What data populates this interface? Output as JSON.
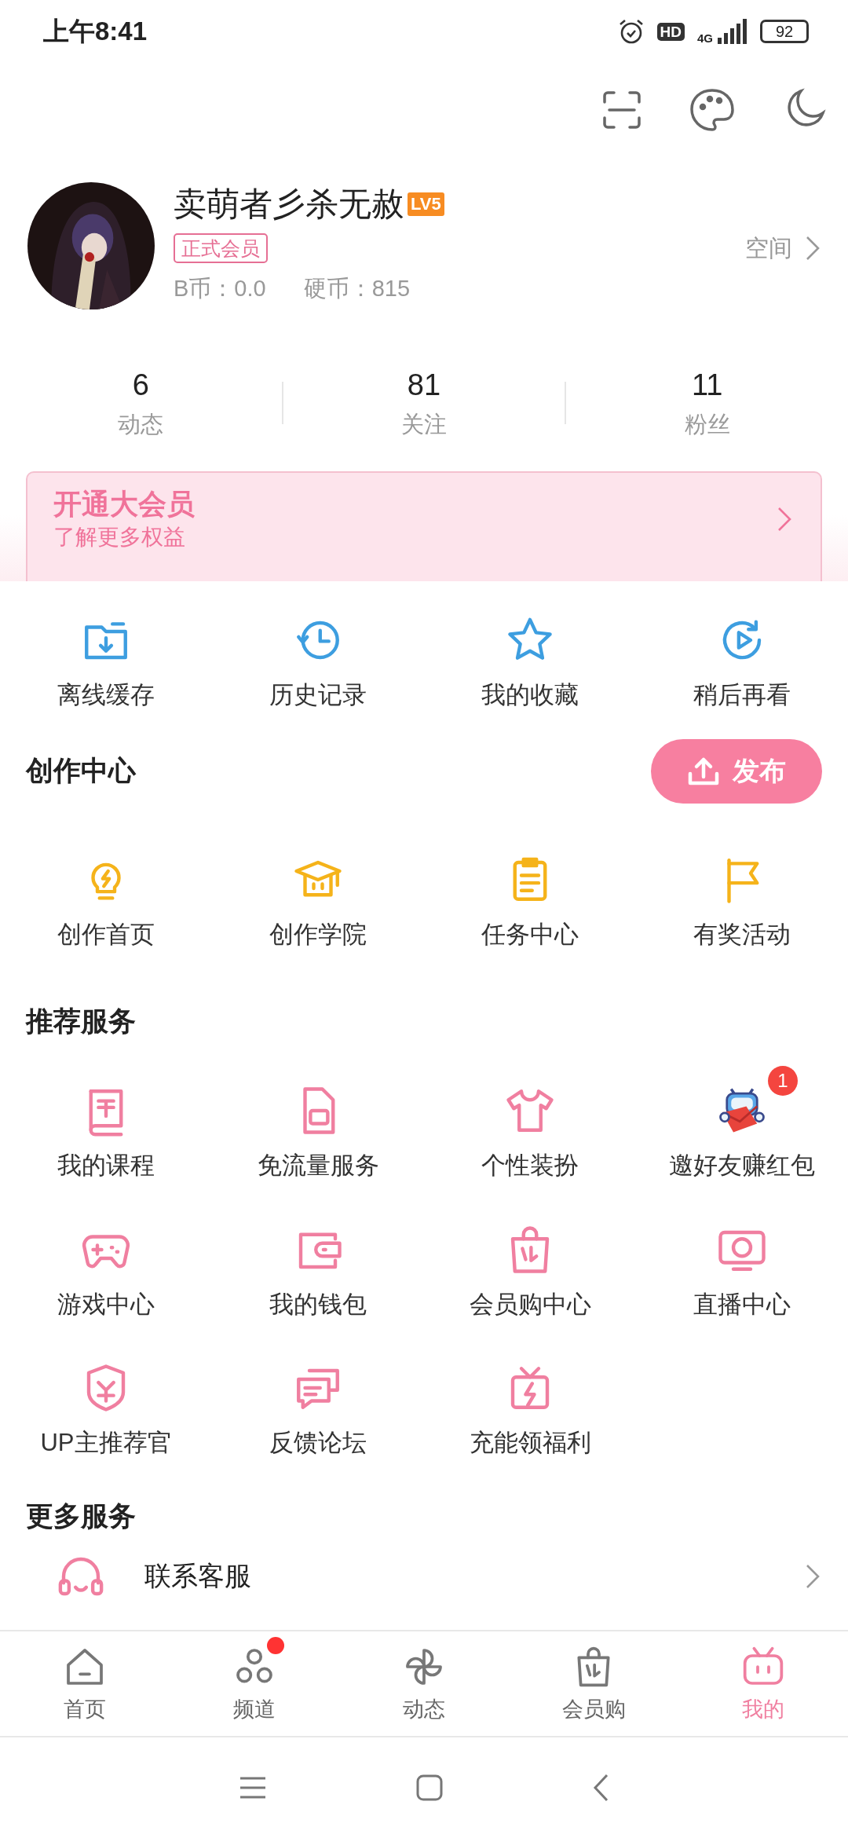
{
  "status_bar": {
    "time": "上午8:41",
    "hd": "HD",
    "network": "4G",
    "battery": "92"
  },
  "profile": {
    "name": "卖萌者彡杀无赦",
    "level": "LV5",
    "member_tag": "正式会员",
    "b_coins": "B币：0.0",
    "coins": "硬币：815",
    "space_link": "空间"
  },
  "stats": [
    {
      "value": "6",
      "label": "动态"
    },
    {
      "value": "81",
      "label": "关注"
    },
    {
      "value": "11",
      "label": "粉丝"
    }
  ],
  "vip_banner": {
    "title": "开通大会员",
    "subtitle": "了解更多权益"
  },
  "quick_actions": [
    {
      "label": "离线缓存",
      "kind": "download-folder"
    },
    {
      "label": "历史记录",
      "kind": "history-clock"
    },
    {
      "label": "我的收藏",
      "kind": "star"
    },
    {
      "label": "稍后再看",
      "kind": "play-later"
    }
  ],
  "creation": {
    "title": "创作中心",
    "publish_button": "发布",
    "items": [
      {
        "label": "创作首页",
        "kind": "bulb"
      },
      {
        "label": "创作学院",
        "kind": "academy-cap"
      },
      {
        "label": "任务中心",
        "kind": "clipboard"
      },
      {
        "label": "有奖活动",
        "kind": "flag"
      }
    ]
  },
  "services": {
    "title": "推荐服务",
    "items": [
      {
        "label": "我的课程",
        "kind": "book"
      },
      {
        "label": "免流量服务",
        "kind": "sim-card"
      },
      {
        "label": "个性装扮",
        "kind": "shirt"
      },
      {
        "label": "邀好友赚红包",
        "kind": "mascot",
        "badge": "1"
      },
      {
        "label": "游戏中心",
        "kind": "gamepad"
      },
      {
        "label": "我的钱包",
        "kind": "wallet"
      },
      {
        "label": "会员购中心",
        "kind": "shopping-bag"
      },
      {
        "label": "直播中心",
        "kind": "tv"
      },
      {
        "label": "UP主推荐官",
        "kind": "shield-badge"
      },
      {
        "label": "反馈论坛",
        "kind": "chat"
      },
      {
        "label": "充能领福利",
        "kind": "gift"
      }
    ]
  },
  "more_services": {
    "title": "更多服务",
    "items": [
      {
        "label": "联系客服",
        "kind": "headset"
      }
    ]
  },
  "bottom_nav": [
    {
      "label": "首页",
      "kind": "home",
      "selected": false,
      "dot": false
    },
    {
      "label": "频道",
      "kind": "circles",
      "selected": false,
      "dot": true
    },
    {
      "label": "动态",
      "kind": "pinwheel",
      "selected": false,
      "dot": false
    },
    {
      "label": "会员购",
      "kind": "shopping-bag",
      "selected": false,
      "dot": false
    },
    {
      "label": "我的",
      "kind": "tv-face",
      "selected": true,
      "dot": false
    }
  ]
}
